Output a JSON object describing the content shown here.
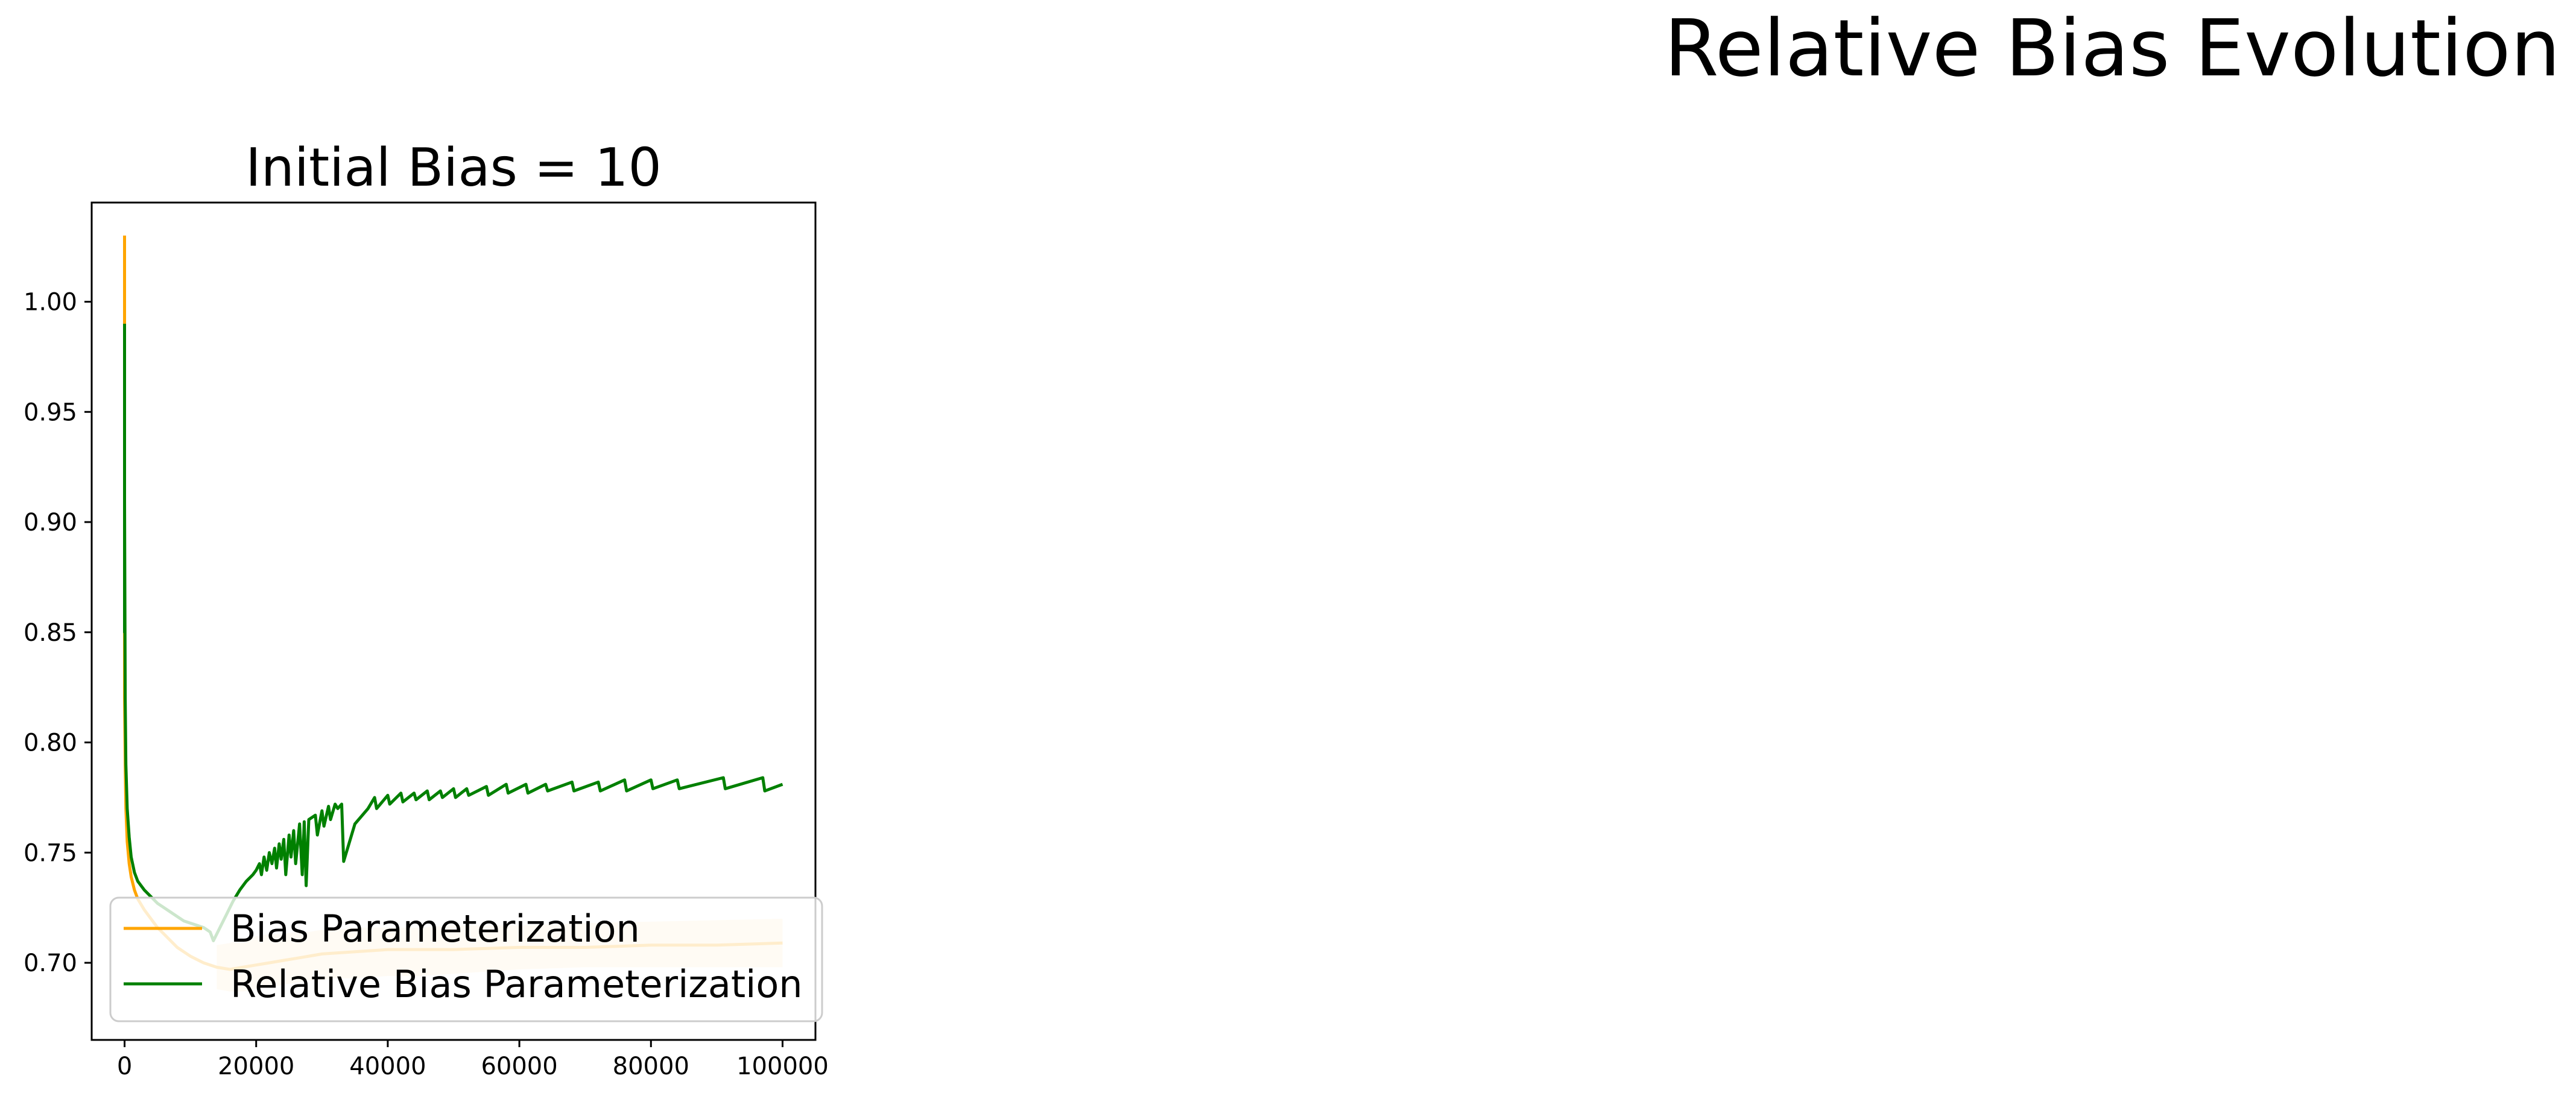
{
  "figure": {
    "suptitle": "Relative Bias Evolution"
  },
  "chart_data": {
    "type": "line",
    "title": "Initial Bias = 10",
    "xlabel": "",
    "ylabel": "",
    "xlim": [
      -5000,
      105000
    ],
    "ylim": [
      0.665,
      1.045
    ],
    "grid": false,
    "legend_position": "lower-left",
    "x_ticks": [
      {
        "value": 0,
        "label": "0"
      },
      {
        "value": 20000,
        "label": "20000"
      },
      {
        "value": 40000,
        "label": "40000"
      },
      {
        "value": 60000,
        "label": "60000"
      },
      {
        "value": 80000,
        "label": "80000"
      },
      {
        "value": 100000,
        "label": "100000"
      }
    ],
    "y_ticks": [
      {
        "value": 0.7,
        "label": "0.70"
      },
      {
        "value": 0.75,
        "label": "0.75"
      },
      {
        "value": 0.8,
        "label": "0.80"
      },
      {
        "value": 0.85,
        "label": "0.85"
      },
      {
        "value": 0.9,
        "label": "0.90"
      },
      {
        "value": 0.95,
        "label": "0.95"
      },
      {
        "value": 1.0,
        "label": "1.00"
      }
    ],
    "series": [
      {
        "name": "Bias Parameterization",
        "color": "#ffa500",
        "band_color": "#ffe9c6",
        "x": [
          0,
          0,
          0,
          100,
          200,
          400,
          700,
          1000,
          1500,
          2000,
          3000,
          4000,
          5000,
          6000,
          7000,
          8000,
          9000,
          10000,
          12000,
          14000,
          16000,
          18000,
          20000,
          22000,
          24000,
          26000,
          28000,
          30000,
          35000,
          40000,
          50000,
          60000,
          70000,
          80000,
          90000,
          100000
        ],
        "y": [
          1.03,
          0.91,
          0.82,
          0.79,
          0.77,
          0.755,
          0.745,
          0.739,
          0.733,
          0.729,
          0.724,
          0.72,
          0.716,
          0.713,
          0.71,
          0.707,
          0.705,
          0.703,
          0.7,
          0.698,
          0.697,
          0.698,
          0.699,
          0.7,
          0.701,
          0.702,
          0.703,
          0.704,
          0.705,
          0.706,
          0.706,
          0.707,
          0.707,
          0.708,
          0.708,
          0.709
        ],
        "band_lower": [
          0.688,
          0.687,
          0.687,
          0.688,
          0.689,
          0.69,
          0.691,
          0.692,
          0.692,
          0.693,
          0.693,
          0.694,
          0.694,
          0.695,
          0.697,
          0.698,
          0.698,
          0.698
        ],
        "band_upper": [
          0.708,
          0.709,
          0.711,
          0.712,
          0.713,
          0.713,
          0.714,
          0.714,
          0.715,
          0.715,
          0.716,
          0.716,
          0.716,
          0.717,
          0.717,
          0.718,
          0.719,
          0.72
        ],
        "band_x": [
          14000,
          16000,
          18000,
          20000,
          22000,
          24000,
          26000,
          28000,
          30000,
          32000,
          35000,
          40000,
          45000,
          50000,
          60000,
          70000,
          85000,
          100000
        ]
      },
      {
        "name": "Relative Bias Parameterization",
        "color": "#008000",
        "x": [
          0,
          0,
          0,
          100,
          200,
          400,
          700,
          1000,
          1500,
          2000,
          3000,
          4000,
          5000,
          6000,
          7000,
          8000,
          9000,
          10000,
          11000,
          12000,
          13000,
          13500,
          14500,
          15500,
          16500,
          17500,
          18500,
          19500,
          20000,
          20500,
          20800,
          21200,
          21600,
          22000,
          22400,
          22800,
          23100,
          23500,
          23800,
          24200,
          24500,
          25000,
          25300,
          25700,
          26000,
          26600,
          27000,
          27300,
          27600,
          28000,
          28500,
          29000,
          29300,
          30000,
          30300,
          31000,
          31300,
          32000,
          32400,
          33000,
          33300,
          35000,
          37000,
          38000,
          38300,
          40000,
          40300,
          42000,
          42300,
          44000,
          44300,
          46000,
          46300,
          48000,
          48300,
          50000,
          50300,
          52000,
          52300,
          55000,
          55300,
          58000,
          58300,
          61000,
          61300,
          64000,
          64300,
          68000,
          68300,
          72000,
          72300,
          76000,
          76300,
          80000,
          80300,
          84000,
          84300,
          91000,
          91300,
          97000,
          97300,
          100000
        ],
        "y": [
          0.99,
          0.85,
          0.91,
          0.82,
          0.79,
          0.77,
          0.757,
          0.748,
          0.741,
          0.737,
          0.733,
          0.73,
          0.727,
          0.725,
          0.723,
          0.721,
          0.719,
          0.718,
          0.717,
          0.716,
          0.714,
          0.71,
          0.716,
          0.722,
          0.728,
          0.733,
          0.737,
          0.74,
          0.742,
          0.745,
          0.74,
          0.748,
          0.742,
          0.75,
          0.745,
          0.752,
          0.743,
          0.754,
          0.747,
          0.756,
          0.74,
          0.758,
          0.748,
          0.76,
          0.745,
          0.763,
          0.74,
          0.764,
          0.735,
          0.765,
          0.766,
          0.767,
          0.758,
          0.769,
          0.762,
          0.771,
          0.765,
          0.772,
          0.77,
          0.772,
          0.746,
          0.763,
          0.77,
          0.775,
          0.77,
          0.776,
          0.772,
          0.777,
          0.773,
          0.777,
          0.774,
          0.778,
          0.774,
          0.778,
          0.775,
          0.779,
          0.775,
          0.779,
          0.776,
          0.78,
          0.776,
          0.781,
          0.777,
          0.781,
          0.777,
          0.781,
          0.778,
          0.782,
          0.778,
          0.782,
          0.778,
          0.783,
          0.778,
          0.783,
          0.779,
          0.783,
          0.779,
          0.784,
          0.779,
          0.784,
          0.778,
          0.781
        ]
      }
    ]
  }
}
